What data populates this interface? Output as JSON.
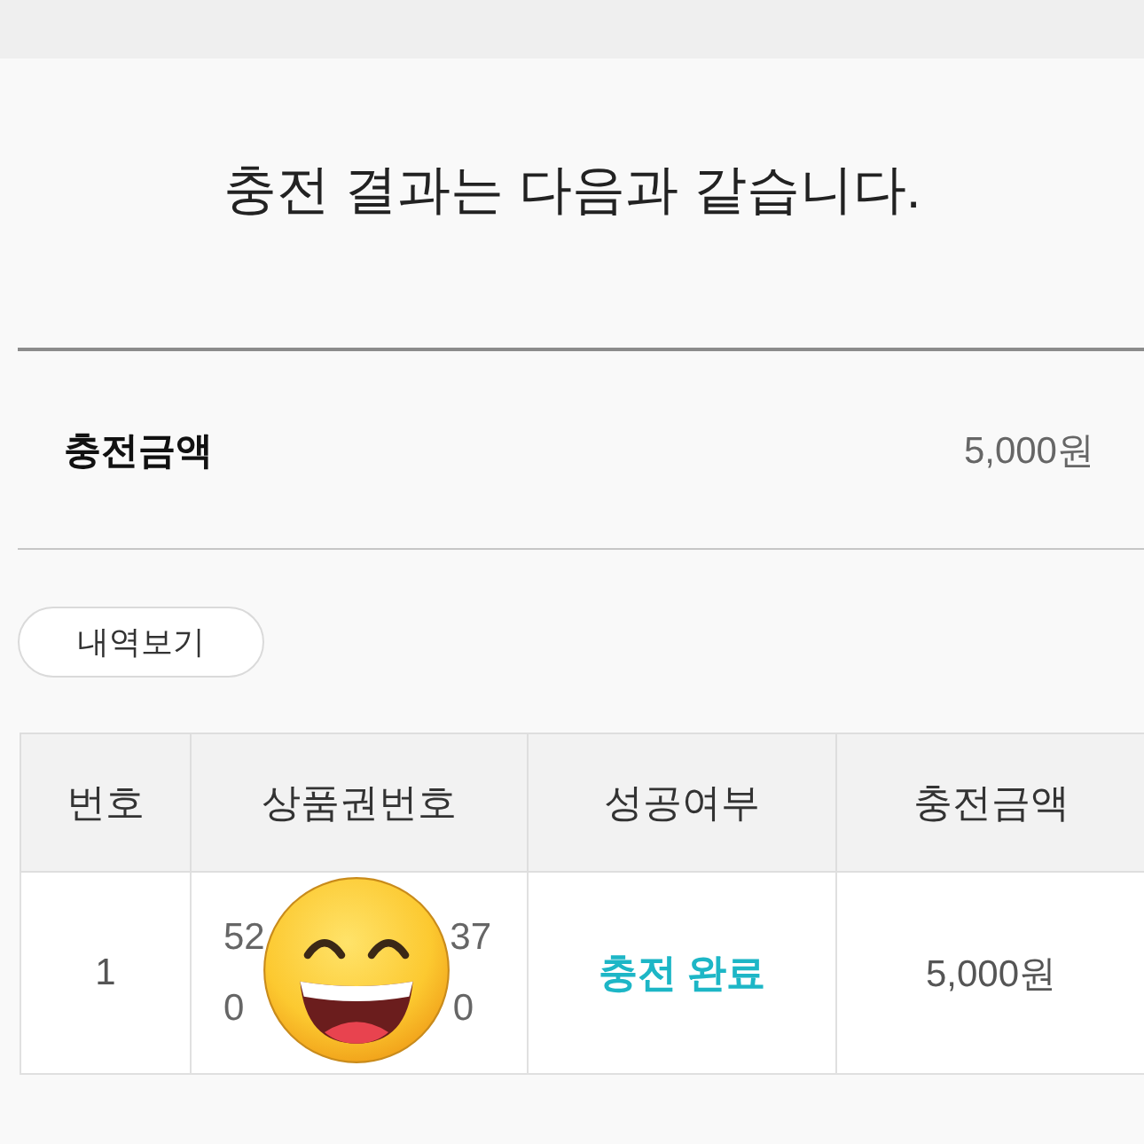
{
  "page": {
    "title": "충전 결과는 다음과 같습니다."
  },
  "summary": {
    "label": "충전금액",
    "value": "5,000원"
  },
  "history_button": {
    "label": "내역보기"
  },
  "table": {
    "columns": [
      "번호",
      "상품권번호",
      "성공여부",
      "충전금액"
    ],
    "rows": [
      {
        "number": "1",
        "voucher_number": {
          "masked": true,
          "lines": [
            [
              "52",
              "37"
            ],
            [
              "0",
              "0"
            ]
          ]
        },
        "status": {
          "kind": "success",
          "text": "충전 완료"
        },
        "amount": "5,000원"
      }
    ]
  }
}
